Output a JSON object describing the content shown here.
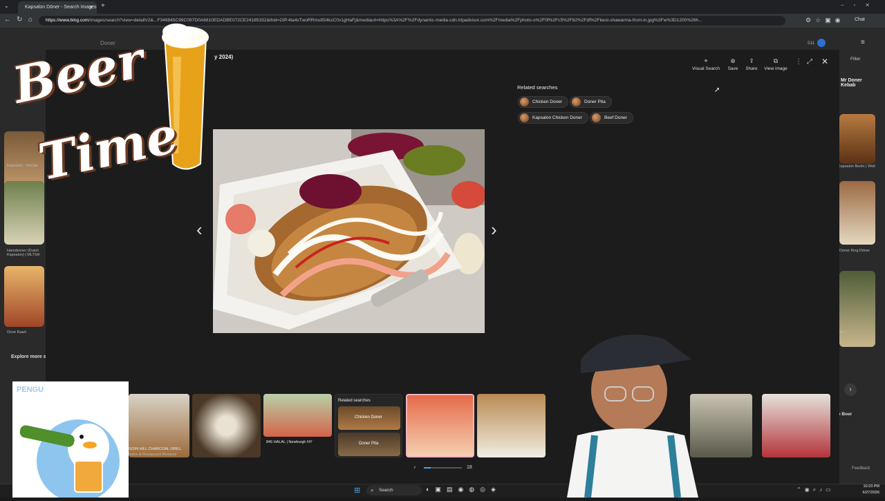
{
  "browser": {
    "tab_title": "Kapsalon Döner - Search Images",
    "url_host": "https://www.bing.com",
    "url_rest": "/images/search?view=detailV2&...F346845C99C097D0A6610EDADBE072CE24185332&thid=OIP.4ta4xTwoRRms8S4kzC0v1gHaFj&mediaurl=https%3A%2F%2Fdynamic-media-cdn.tripadvisor.com%2Fmedia%2Fphoto-o%2F0f%2Fc5%2F82%2Fdf%2Fbest-shawarma-from-in.jpg%3Fw%3D1200%26h...",
    "chat_label": "Chat"
  },
  "page_behind": {
    "search_text": "Doner",
    "points": "511",
    "filter_label": "Filter",
    "left_captions": [
      "Kapsalon - Recipe",
      "Hamdesner (Dutch Kapsalon) | MLTSH",
      "Onze Kaart"
    ],
    "explore_label": "Explore more s",
    "right_header": "Mr Doner Kebab",
    "right_captions": [
      "Kapsalon Berlin | Wolt",
      "Doner King Döner",
      "rion |",
      "e Boer"
    ],
    "feedback": "Feedback"
  },
  "viewer": {
    "title_fragment": "y 2024)",
    "tools": [
      {
        "icon": "visual-search-icon",
        "glyph": "⌖",
        "label": "Visual Search"
      },
      {
        "icon": "save-icon",
        "glyph": "⊕",
        "label": "Save"
      },
      {
        "icon": "share-icon",
        "glyph": "⇪",
        "label": "Share"
      },
      {
        "icon": "view-image-icon",
        "glyph": "⧉",
        "label": "View image"
      }
    ],
    "related_heading": "Related searches",
    "related": [
      "Chicken Doner",
      "Doner Pita",
      "Kapsalon Chicken Doner",
      "Beef Doner"
    ],
    "carousel": {
      "captions": [
        "GGIN HILL CHARCOAL GRILL",
        "hotos & Restaurant Reviews",
        "845 HALAL | Newburgh NY"
      ],
      "related_heading": "Related searches",
      "related": [
        "Chicken Doner",
        "Doner Pita"
      ]
    }
  },
  "volume": {
    "value": "18"
  },
  "taskbar": {
    "search_label": "Search",
    "time": "10:23 PM",
    "date": "6/27/2026"
  },
  "overlays": {
    "beer_word1": "Beer",
    "beer_word2": "Time",
    "penguin_text": "PENGU"
  }
}
